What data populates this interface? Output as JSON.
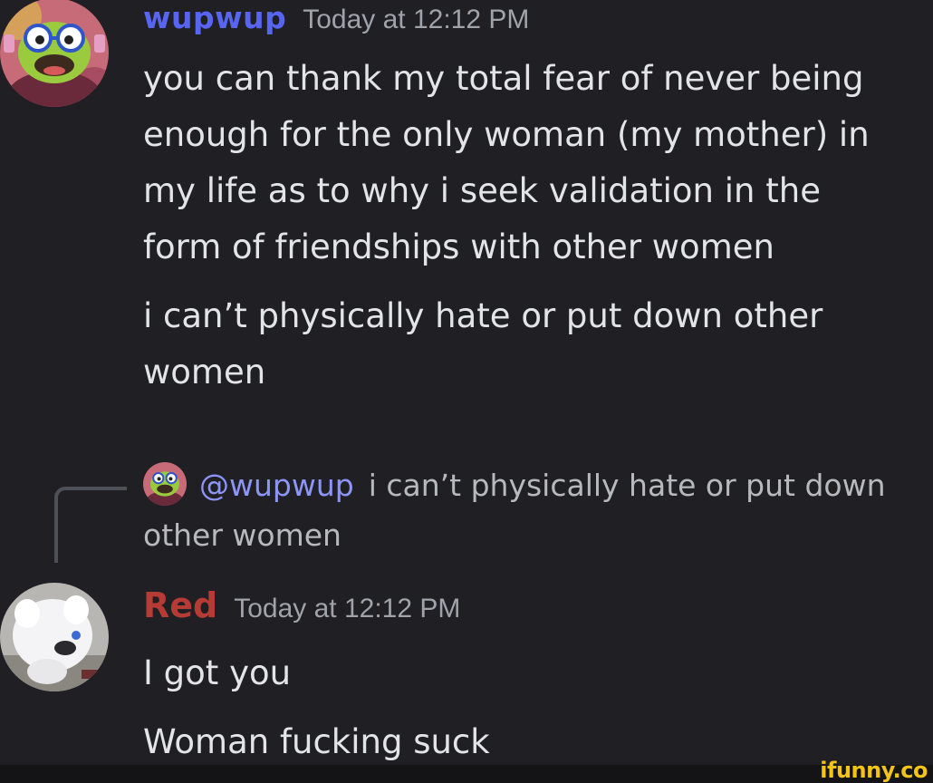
{
  "messages": [
    {
      "author": "wupwup",
      "author_color": "#5865f2",
      "timestamp": "Today at 12:12 PM",
      "avatar_icon": "green-creature-with-glasses-avatar",
      "lines": [
        "you can thank my total fear of never being",
        "enough for the only woman (my mother) in",
        "my life as to why i seek validation in the",
        "form of friendships with other women",
        "i can’t physically hate or put down other",
        "women"
      ]
    },
    {
      "author": "Red",
      "author_color": "#b73b35",
      "timestamp": "Today at 12:12 PM",
      "avatar_icon": "white-furry-creature-avatar",
      "reply": {
        "mention": "@wupwup",
        "mention_color": "#8d95f6",
        "text_line1": "i can’t physically hate or put down",
        "text_line2": "other women"
      },
      "lines": [
        "I got you",
        "Woman fucking suck"
      ]
    }
  ],
  "watermark": {
    "text": "ifunny.co",
    "color": "#f2c418"
  }
}
